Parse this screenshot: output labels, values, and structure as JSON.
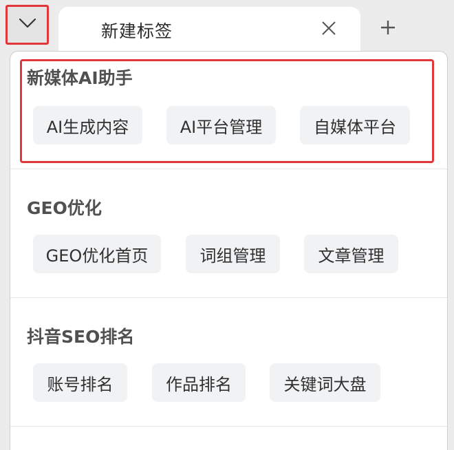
{
  "tab": {
    "title": "新建标签",
    "close_icon": "close-icon",
    "new_tab_icon": "plus-icon",
    "dropdown_icon": "chevron-down-icon"
  },
  "menu": {
    "sections": [
      {
        "title": "新媒体AI助手",
        "items": [
          "AI生成内容",
          "AI平台管理",
          "自媒体平台"
        ]
      },
      {
        "title": "GEO优化",
        "items": [
          "GEO优化首页",
          "词组管理",
          "文章管理"
        ]
      },
      {
        "title": "抖音SEO排名",
        "items": [
          "账号排名",
          "作品排名",
          "关键词大盘"
        ]
      }
    ]
  },
  "colors": {
    "highlight": "#e0383a",
    "chip_bg": "#f1f2f4",
    "section_title": "#505050"
  }
}
